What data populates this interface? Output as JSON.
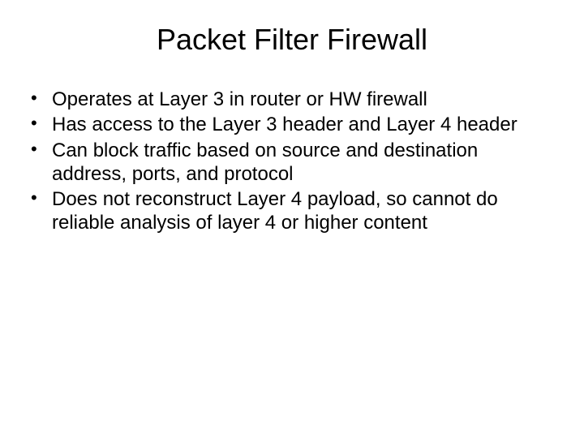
{
  "slide": {
    "title": "Packet Filter Firewall",
    "bullets": [
      "Operates at Layer 3 in router or HW firewall",
      "Has access to the Layer 3 header and Layer 4 header",
      "Can block traffic based on source and destination address, ports, and protocol",
      "Does not reconstruct Layer 4 payload, so cannot do reliable analysis of layer 4 or higher content"
    ]
  }
}
